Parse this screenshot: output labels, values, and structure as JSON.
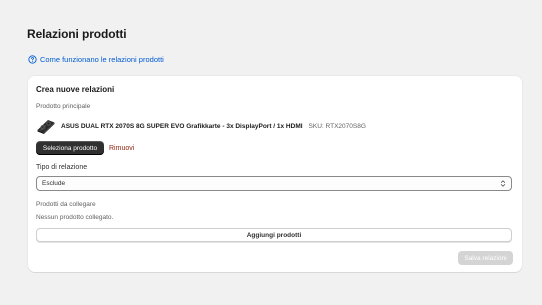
{
  "page": {
    "title": "Relazioni prodotti",
    "help_link": "Come funzionano le relazioni prodotti"
  },
  "card": {
    "title": "Crea nuove relazioni",
    "main_product_label": "Prodotto principale",
    "product": {
      "name": "ASUS DUAL RTX 2070S 8G SUPER EVO Grafikkarte - 3x DisplayPort / 1x HDMI",
      "sku": "SKU: RTX2070S8G"
    },
    "select_product_label": "Seleziona prodotto",
    "remove_label": "Rimuovi",
    "relation_type_label": "Tipo di relazione",
    "relation_type_value": "Esclude",
    "linked_products_label": "Prodotti da collegare",
    "empty_text": "Nessun prodotto collegato.",
    "add_products_label": "Aggiungi prodotti",
    "save_label": "Salva relazioni"
  },
  "colors": {
    "background": "#f1f1f1",
    "link": "#005bd3",
    "primary_button": "#303030",
    "remove": "#8e1f0b",
    "disabled_button": "#d4d4d4"
  },
  "icons": {
    "help": "question-circle-icon",
    "select": "chevron-up-down-icon",
    "product": "graphics-card-thumbnail"
  }
}
